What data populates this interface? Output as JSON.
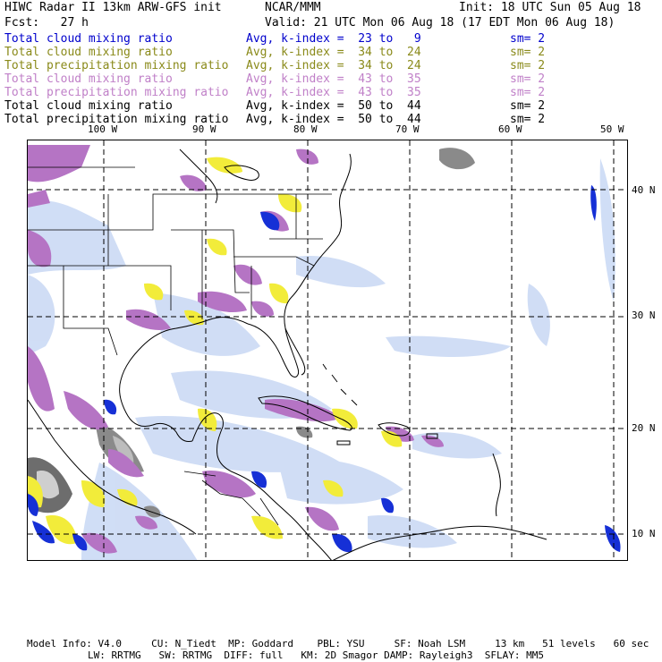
{
  "header": {
    "title": "HIWC Radar II 13km ARW-GFS init",
    "org": "NCAR/MMM",
    "init": "Init: 18 UTC Sun 05 Aug 18",
    "fcst": "Fcst:   27 h",
    "valid": "Valid: 21 UTC Mon 06 Aug 18 (17 EDT Mon 06 Aug 18)"
  },
  "legend": [
    {
      "label": "Total cloud mixing ratio",
      "avg": "Avg, k-index =  23 to   9",
      "sm": "sm= 2",
      "color": "#0000cc"
    },
    {
      "label": "Total cloud mixing ratio",
      "avg": "Avg, k-index =  34 to  24",
      "sm": "sm= 2",
      "color": "#8a8a1a"
    },
    {
      "label": "Total precipitation mixing ratio",
      "avg": "Avg, k-index =  34 to  24",
      "sm": "sm= 2",
      "color": "#8a8a1a"
    },
    {
      "label": "Total cloud mixing ratio",
      "avg": "Avg, k-index =  43 to  35",
      "sm": "sm= 2",
      "color": "#c080c8"
    },
    {
      "label": "Total precipitation mixing ratio",
      "avg": "Avg, k-index =  43 to  35",
      "sm": "sm= 2",
      "color": "#c080c8"
    },
    {
      "label": "Total cloud mixing ratio",
      "avg": "Avg, k-index =  50 to  44",
      "sm": "sm= 2",
      "color": "#000000"
    },
    {
      "label": "Total precipitation mixing ratio",
      "avg": "Avg, k-index =  50 to  44",
      "sm": "sm= 2",
      "color": "#000000"
    }
  ],
  "axes": {
    "lon_labels": [
      "100 W",
      "90 W",
      "80 W",
      "70 W",
      "60 W",
      "50 W"
    ],
    "lat_labels": [
      "40 N",
      "30 N",
      "20 N",
      "10 N"
    ]
  },
  "footer": {
    "line1": "Model Info: V4.0     CU: N_Tiedt  MP: Goddard    PBL: YSU     SF: Noah LSM     13 km   51 levels   60 sec",
    "line2": "LW: RRTMG   SW: RRTMG  DIFF: full   KM: 2D Smagor DAMP: Rayleigh3  SFLAY: MM5"
  },
  "colors": {
    "cloud_low": "#0000cc",
    "yellow_field": "#f0f040",
    "purple_field": "#b070c0",
    "gray_field": "#888888",
    "light_blue_field": "#b8ccf0"
  }
}
